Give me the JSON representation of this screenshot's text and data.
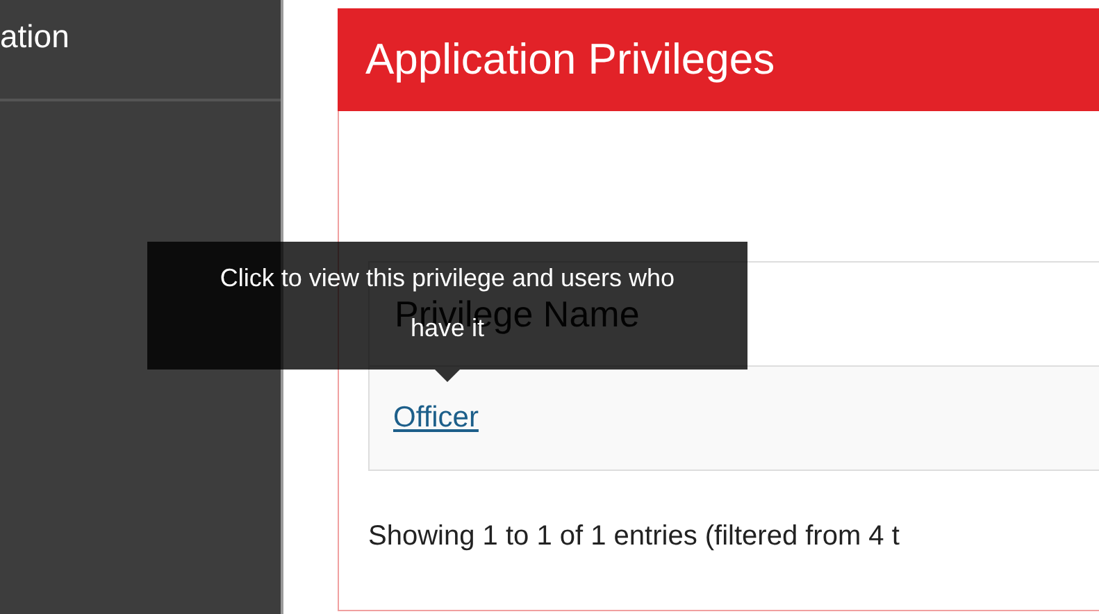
{
  "sidebar": {
    "items": [
      {
        "label": "ation"
      }
    ]
  },
  "panel": {
    "title": "Application Privileges",
    "table": {
      "columns": [
        "Privilege Name"
      ],
      "rows": [
        {
          "name": "Officer"
        }
      ]
    },
    "info": "Showing 1 to 1 of 1 entries (filtered from 4 t"
  },
  "tooltip": {
    "text": "Click to view this privilege and users who have it"
  }
}
